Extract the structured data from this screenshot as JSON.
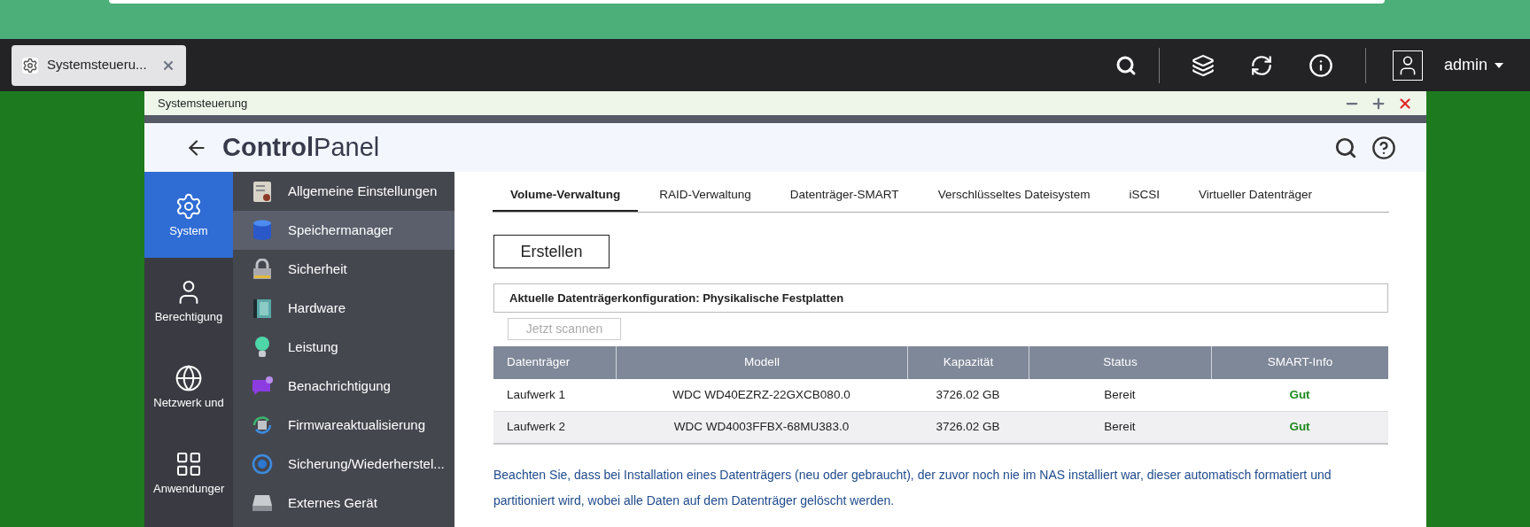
{
  "taskbar": {
    "tab": {
      "label": "Systemsteueru..."
    },
    "user": "admin"
  },
  "window": {
    "title": "Systemsteuerung",
    "header": {
      "title_bold": "Control",
      "title_light": "Panel"
    },
    "categories": [
      {
        "label": "System",
        "selected": true
      },
      {
        "label": "Berechtigung",
        "selected": false
      },
      {
        "label": "Netzwerk und",
        "selected": false
      },
      {
        "label": "Anwendunger",
        "selected": false
      }
    ],
    "menu": [
      {
        "label": "Allgemeine Einstellungen",
        "selected": false
      },
      {
        "label": "Speichermanager",
        "selected": true
      },
      {
        "label": "Sicherheit",
        "selected": false
      },
      {
        "label": "Hardware",
        "selected": false
      },
      {
        "label": "Leistung",
        "selected": false
      },
      {
        "label": "Benachrichtigung",
        "selected": false
      },
      {
        "label": "Firmwareaktualisierung",
        "selected": false
      },
      {
        "label": "Sicherung/Wiederherstel...",
        "selected": false
      },
      {
        "label": "Externes Gerät",
        "selected": false
      }
    ],
    "tabs": [
      {
        "label": "Volume-Verwaltung",
        "selected": true
      },
      {
        "label": "RAID-Verwaltung",
        "selected": false
      },
      {
        "label": "Datenträger-SMART",
        "selected": false
      },
      {
        "label": "Verschlüsseltes Dateisystem",
        "selected": false
      },
      {
        "label": "iSCSI",
        "selected": false
      },
      {
        "label": "Virtueller Datenträger",
        "selected": false
      }
    ],
    "create_button": "Erstellen",
    "config_panel": {
      "title": "Aktuelle Datenträgerkonfiguration: Physikalische Festplatten",
      "scan_button": {
        "label": "Jetzt scannen",
        "disabled": true
      }
    },
    "table": {
      "columns": [
        "Datenträger",
        "Modell",
        "Kapazität",
        "Status",
        "SMART-Info"
      ],
      "rows": [
        [
          "Laufwerk 1",
          "WDC WD40EZRZ-22GXCB080.0",
          "3726.02 GB",
          "Bereit",
          "Gut"
        ],
        [
          "Laufwerk 2",
          "WDC WD4003FFBX-68MU383.0",
          "3726.02 GB",
          "Bereit",
          "Gut"
        ]
      ]
    },
    "notice": "Beachten Sie, dass bei Installation eines Datenträgers (neu oder gebraucht), der zuvor noch nie im NAS installiert war, dieser automatisch formatiert und partitioniert wird, wobei alle Daten auf dem Datenträger gelöscht werden."
  }
}
